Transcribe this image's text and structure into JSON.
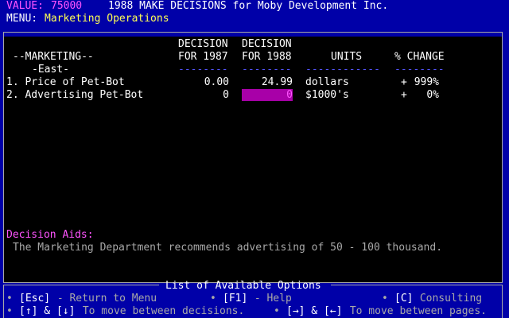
{
  "header": {
    "value_label": "VALUE:",
    "value": "75000",
    "title": "1988 MAKE DECISIONS for Moby Development Inc.",
    "menu_label": "MENU:",
    "menu_value": "Marketing Operations"
  },
  "table": {
    "section_title": "--MARKETING--",
    "region": "-East-",
    "columns": {
      "decision_1987_line1": "DECISION",
      "decision_1987_line2": "FOR 1987",
      "decision_1988_line1": "DECISION",
      "decision_1988_line2": "FOR 1988",
      "units": "UNITS",
      "pct_change": "% CHANGE"
    },
    "dashes": {
      "col1987": "--------",
      "col1988": "--------",
      "units": "------------",
      "pct": "--------"
    },
    "rows": [
      {
        "label": "1. Price of Pet-Bot",
        "val_1987": "0.00",
        "val_1988": "24.99",
        "units": "dollars",
        "sign": "+",
        "pct": "999%"
      },
      {
        "label": "2. Advertising Pet-Bot",
        "val_1987": "0",
        "val_1988": "0",
        "units": "$1000's",
        "sign": "+",
        "pct": "0%"
      }
    ]
  },
  "aids": {
    "title": "Decision Aids:",
    "text": "The Marketing Department recommends advertising of 50 - 100 thousand."
  },
  "options": {
    "title": "List of Available Options",
    "items": [
      {
        "bullet": "•",
        "key": "[Esc]",
        "desc": " - Return to Menu"
      },
      {
        "bullet": "•",
        "key": "[F1]",
        "desc": " - Help"
      },
      {
        "bullet": "•",
        "key": "[C]",
        "desc": " Consulting"
      },
      {
        "bullet": "•",
        "key": "[↑] & [↓]",
        "desc": " To move between decisions."
      },
      {
        "bullet": "•",
        "key": "[→] & [←]",
        "desc": " To move between pages."
      }
    ]
  },
  "colors": {
    "background": "#0000a8",
    "panel": "#000000",
    "highlight": "#a800a8",
    "label_accent": "#ff54ff",
    "value_accent": "#ffff54"
  }
}
